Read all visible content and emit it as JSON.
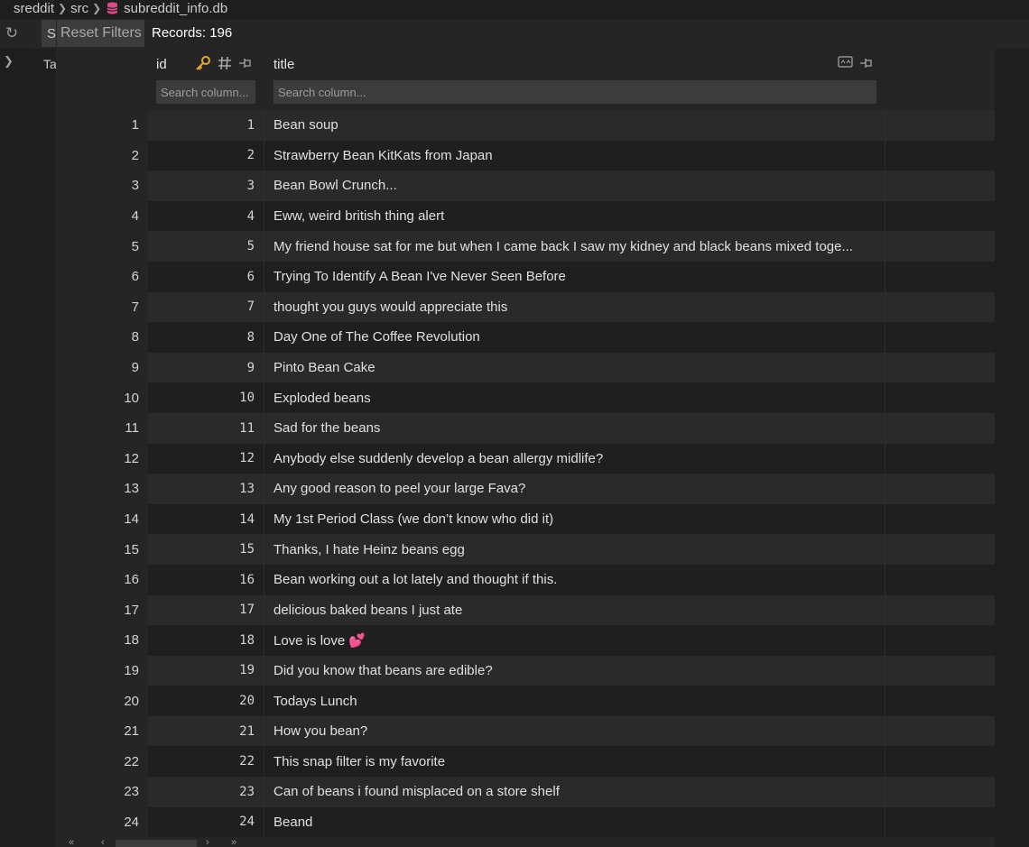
{
  "breadcrumb": {
    "items": [
      "sreddit",
      "src",
      "subreddit_info.db"
    ]
  },
  "toolbar": {
    "partial_button": "S",
    "reset_label": "Reset Filters",
    "records_label": "Records: 196"
  },
  "tree": {
    "partial_label": "Ta"
  },
  "columns": {
    "id": {
      "name": "id",
      "placeholder": "Search column..."
    },
    "title": {
      "name": "title",
      "placeholder": "Search column..."
    }
  },
  "colors": {
    "key_icon": "#e7a733",
    "db_icon": "#e1488a",
    "emoji": "#ff4a8d"
  },
  "rows": [
    {
      "n": "1",
      "id": "1",
      "title": "Bean soup"
    },
    {
      "n": "2",
      "id": "2",
      "title": "Strawberry Bean KitKats from Japan"
    },
    {
      "n": "3",
      "id": "3",
      "title": "Bean Bowl Crunch..."
    },
    {
      "n": "4",
      "id": "4",
      "title": "Eww, weird british thing alert"
    },
    {
      "n": "5",
      "id": "5",
      "title": "My friend house sat for me but when I came back I saw my kidney and black beans mixed toge..."
    },
    {
      "n": "6",
      "id": "6",
      "title": "Trying To Identify A Bean I've Never Seen Before"
    },
    {
      "n": "7",
      "id": "7",
      "title": "thought you guys would appreciate this"
    },
    {
      "n": "8",
      "id": "8",
      "title": "Day One of The Coffee Revolution"
    },
    {
      "n": "9",
      "id": "9",
      "title": "Pinto Bean Cake"
    },
    {
      "n": "10",
      "id": "10",
      "title": "Exploded beans"
    },
    {
      "n": "11",
      "id": "11",
      "title": "Sad for the beans"
    },
    {
      "n": "12",
      "id": "12",
      "title": "Anybody else suddenly develop a bean allergy midlife?"
    },
    {
      "n": "13",
      "id": "13",
      "title": "Any good reason to peel your large Fava?"
    },
    {
      "n": "14",
      "id": "14",
      "title": "My 1st Period Class (we don’t know who did it)"
    },
    {
      "n": "15",
      "id": "15",
      "title": "Thanks, I hate Heinz beans egg"
    },
    {
      "n": "16",
      "id": "16",
      "title": "Bean working out a lot lately and thought if this."
    },
    {
      "n": "17",
      "id": "17",
      "title": "delicious baked beans I just ate"
    },
    {
      "n": "18",
      "id": "18",
      "title": "Love is love 💕"
    },
    {
      "n": "19",
      "id": "19",
      "title": "Did you know that beans are edible?"
    },
    {
      "n": "20",
      "id": "20",
      "title": "Todays Lunch"
    },
    {
      "n": "21",
      "id": "21",
      "title": "How you bean?"
    },
    {
      "n": "22",
      "id": "22",
      "title": "This snap filter is my favorite"
    },
    {
      "n": "23",
      "id": "23",
      "title": "Can of beans i found misplaced on a store shelf"
    },
    {
      "n": "24",
      "id": "24",
      "title": "Beand"
    }
  ]
}
